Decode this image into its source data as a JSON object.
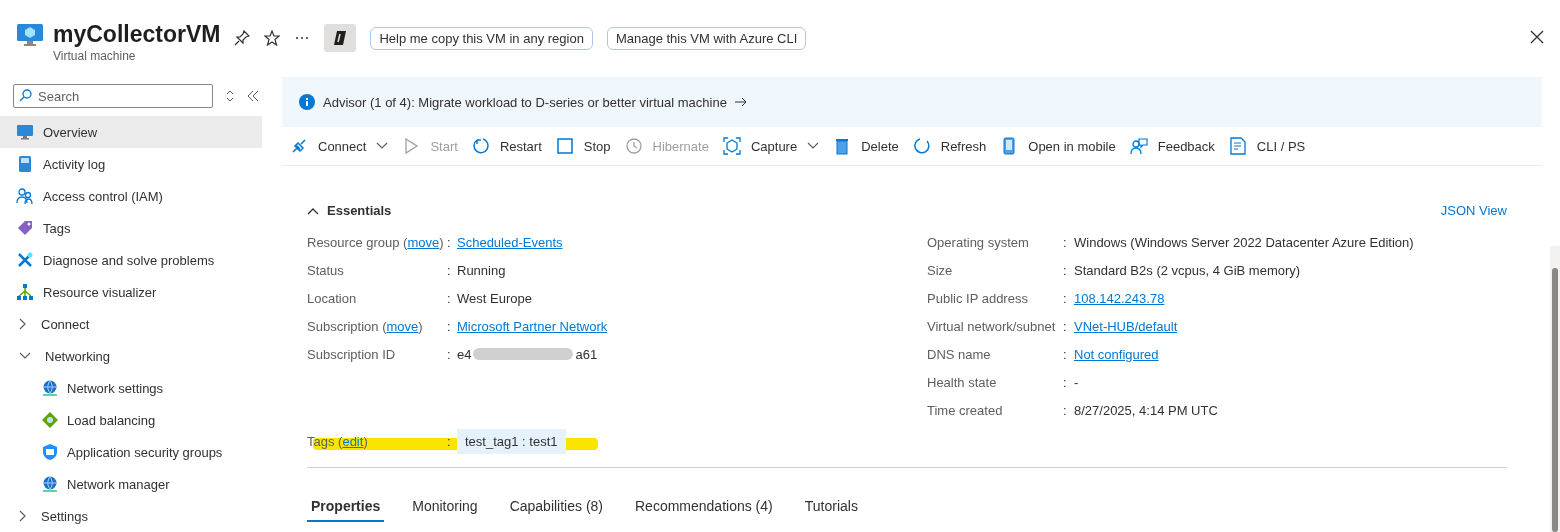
{
  "header": {
    "title": "myCollectorVM",
    "subtitle": "Virtual machine",
    "prompts": [
      "Help me copy this VM in any region",
      "Manage this VM with Azure CLI"
    ]
  },
  "sidebar": {
    "search": {
      "placeholder": "Search"
    },
    "items": [
      {
        "label": "Overview",
        "kind": "item",
        "selected": true
      },
      {
        "label": "Activity log",
        "kind": "item",
        "selected": false
      },
      {
        "label": "Access control (IAM)",
        "kind": "item",
        "selected": false
      },
      {
        "label": "Tags",
        "kind": "item",
        "selected": false
      },
      {
        "label": "Diagnose and solve problems",
        "kind": "item",
        "selected": false
      },
      {
        "label": "Resource visualizer",
        "kind": "item",
        "selected": false
      },
      {
        "label": "Connect",
        "kind": "group",
        "expanded": false,
        "selected": false
      },
      {
        "label": "Networking",
        "kind": "group",
        "expanded": true,
        "selected": false,
        "children": [
          {
            "label": "Network settings",
            "kind": "item",
            "selected": false
          },
          {
            "label": "Load balancing",
            "kind": "item",
            "selected": false
          },
          {
            "label": "Application security groups",
            "kind": "item",
            "selected": false
          },
          {
            "label": "Network manager",
            "kind": "item",
            "selected": false
          }
        ]
      },
      {
        "label": "Settings",
        "kind": "group",
        "expanded": false,
        "selected": false
      }
    ]
  },
  "advisor": {
    "text": "Advisor (1 of 4): Migrate workload to D-series or better virtual machine"
  },
  "toolbar": [
    {
      "label": "Connect",
      "disabled": false,
      "dropdown": true
    },
    {
      "label": "Start",
      "disabled": true,
      "dropdown": false
    },
    {
      "label": "Restart",
      "disabled": false,
      "dropdown": false
    },
    {
      "label": "Stop",
      "disabled": false,
      "dropdown": false
    },
    {
      "label": "Hibernate",
      "disabled": true,
      "dropdown": false
    },
    {
      "label": "Capture",
      "disabled": false,
      "dropdown": true
    },
    {
      "label": "Delete",
      "disabled": false,
      "dropdown": false
    },
    {
      "label": "Refresh",
      "disabled": false,
      "dropdown": false
    },
    {
      "label": "Open in mobile",
      "disabled": false,
      "dropdown": false
    },
    {
      "label": "Feedback",
      "disabled": false,
      "dropdown": false
    },
    {
      "label": "CLI / PS",
      "disabled": false,
      "dropdown": false
    }
  ],
  "essentials": {
    "title": "Essentials",
    "expanded": true,
    "json_view": "JSON View",
    "left": [
      {
        "label": "Resource group (",
        "action": "move",
        "label_end": ")",
        "separator": ":",
        "kind": "link",
        "value": "Scheduled-Events"
      },
      {
        "label": "Status",
        "separator": ":",
        "kind": "text",
        "value": "Running"
      },
      {
        "label": "Location",
        "separator": ":",
        "kind": "text",
        "value": "West Europe"
      },
      {
        "label": "Subscription (",
        "action": "move",
        "label_end": ")",
        "separator": ":",
        "kind": "link",
        "value": "Microsoft Partner Network"
      },
      {
        "label": "Subscription ID",
        "separator": ":",
        "kind": "redacted",
        "value": "e4",
        "value_end": "a61"
      }
    ],
    "right": [
      {
        "label": "Operating system",
        "separator": ":",
        "kind": "text",
        "value": "Windows (Windows Server 2022 Datacenter Azure Edition)"
      },
      {
        "label": "Size",
        "separator": ":",
        "kind": "text",
        "value": "Standard B2s (2 vcpus, 4 GiB memory)"
      },
      {
        "label": "Public IP address",
        "separator": ":",
        "kind": "link",
        "value": "108.142.243.78"
      },
      {
        "label": "Virtual network/subnet",
        "separator": ":",
        "kind": "link",
        "value": "VNet-HUB/default"
      },
      {
        "label": "DNS name",
        "separator": ":",
        "kind": "link",
        "value": "Not configured"
      },
      {
        "label": "Health state",
        "separator": ":",
        "kind": "text",
        "value": "-"
      },
      {
        "label": "Time created",
        "separator": ":",
        "kind": "text",
        "value": "8/27/2025, 4:14 PM UTC"
      }
    ],
    "tags": {
      "label": "Tags (",
      "action": "edit",
      "label_end": ")",
      "separator": ":",
      "value": "test_tag1 : test1",
      "highlighted": true
    }
  },
  "tabs": [
    {
      "label": "Properties",
      "selected": true
    },
    {
      "label": "Monitoring",
      "selected": false
    },
    {
      "label": "Capabilities (8)",
      "selected": false
    },
    {
      "label": "Recommendations (4)",
      "selected": false
    },
    {
      "label": "Tutorials",
      "selected": false
    }
  ]
}
